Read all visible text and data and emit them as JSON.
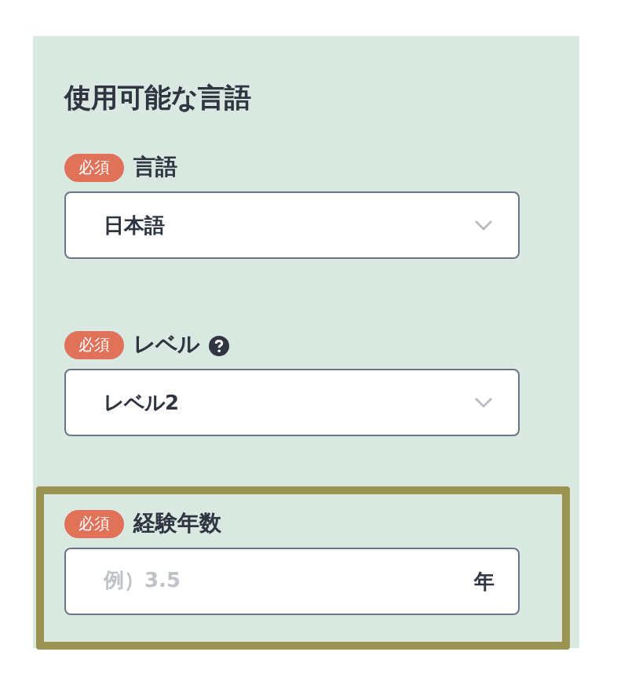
{
  "title": "使用可能な言語",
  "fields": [
    {
      "kind": "select",
      "badge": "必須",
      "label": "言語",
      "help": false,
      "highlighted": false,
      "value": "日本語"
    },
    {
      "kind": "select",
      "badge": "必須",
      "label": "レベル",
      "help": true,
      "highlighted": false,
      "value": "レベル2"
    },
    {
      "kind": "input",
      "badge": "必須",
      "label": "経験年数",
      "help": false,
      "highlighted": true,
      "placeholder": "例）3.5",
      "unit": "年"
    }
  ]
}
